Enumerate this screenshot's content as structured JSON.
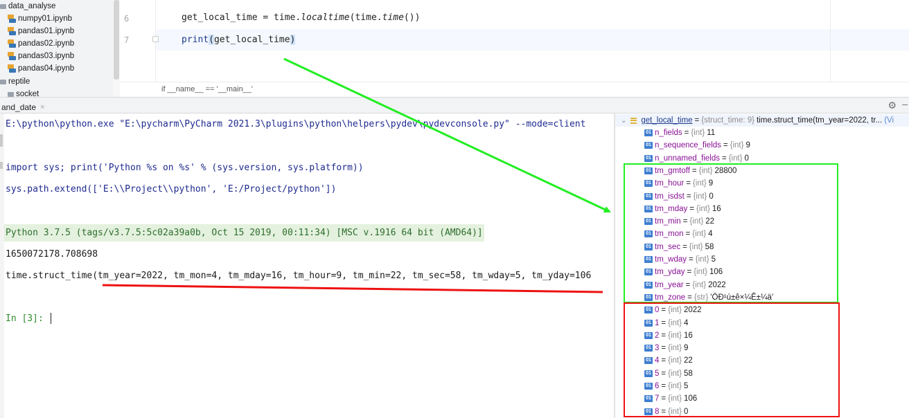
{
  "project_tree": {
    "items": [
      {
        "kind": "folder",
        "label": "data_analyse"
      },
      {
        "kind": "notebook",
        "label": "numpy01.ipynb"
      },
      {
        "kind": "notebook",
        "label": "pandas01.ipynb"
      },
      {
        "kind": "notebook",
        "label": "pandas02.ipynb"
      },
      {
        "kind": "notebook",
        "label": "pandas03.ipynb"
      },
      {
        "kind": "notebook",
        "label": "pandas04.ipynb"
      },
      {
        "kind": "folder",
        "label": "reptile"
      },
      {
        "kind": "folder",
        "label": "socket"
      }
    ]
  },
  "editor": {
    "line_numbers": [
      "6",
      "7"
    ],
    "line6": {
      "prefix": "get_local_time = time.",
      "fn1": "localtime",
      "mid": "(time.",
      "fn2": "time",
      "suffix": "())"
    },
    "line7": {
      "fn": "print",
      "open": "(",
      "arg": "get_local_time",
      "close": ")"
    },
    "breadcrumb": "if __name__ == '__main__'"
  },
  "run_tab": {
    "label": "and_date",
    "close_glyph": "×",
    "settings_icon": "gear-icon",
    "minimize_glyph": "–"
  },
  "console": {
    "lines": {
      "cmd1": "E:\\python\\python.exe \"E:\\pycharm\\PyCharm 2021.3\\plugins\\python\\helpers\\pydev\\pydevconsole.py\" --mode=client",
      "cmd2": "import sys; print('Python %s on %s' % (sys.version, sys.platform))",
      "cmd3": "sys.path.extend(['E:\\\\Project\\\\python', 'E:/Project/python'])",
      "banner": "Python 3.7.5 (tags/v3.7.5:5c02a39a0b, Oct 15 2019, 00:11:34) [MSC v.1916 64 bit (AMD64)]",
      "out1": "1650072178.708698",
      "out2": "time.struct_time(tm_year=2022, tm_mon=4, tm_mday=16, tm_hour=9, tm_min=22, tm_sec=58, tm_wday=5, tm_yday=106",
      "prompt": "In [3]:"
    }
  },
  "variables": {
    "header": {
      "name": "get_local_time",
      "eq": "=",
      "type": "{struct_time: 9}",
      "value": "time.struct_time(tm_year=2022, tr...",
      "more": "(Vi"
    },
    "icon_text": "01",
    "fields": [
      {
        "name": "n_fields",
        "type": "{int}",
        "value": "11"
      },
      {
        "name": "n_sequence_fields",
        "type": "{int}",
        "value": "9"
      },
      {
        "name": "n_unnamed_fields",
        "type": "{int}",
        "value": "0"
      },
      {
        "name": "tm_gmtoff",
        "type": "{int}",
        "value": "28800"
      },
      {
        "name": "tm_hour",
        "type": "{int}",
        "value": "9"
      },
      {
        "name": "tm_isdst",
        "type": "{int}",
        "value": "0"
      },
      {
        "name": "tm_mday",
        "type": "{int}",
        "value": "16"
      },
      {
        "name": "tm_min",
        "type": "{int}",
        "value": "22"
      },
      {
        "name": "tm_mon",
        "type": "{int}",
        "value": "4"
      },
      {
        "name": "tm_sec",
        "type": "{int}",
        "value": "58"
      },
      {
        "name": "tm_wday",
        "type": "{int}",
        "value": "5"
      },
      {
        "name": "tm_yday",
        "type": "{int}",
        "value": "106"
      },
      {
        "name": "tm_year",
        "type": "{int}",
        "value": "2022"
      },
      {
        "name": "tm_zone",
        "type": "{str}",
        "value": "'ÖÐ¹ú±ê×¼Ê±¼ä'"
      }
    ],
    "indices": [
      {
        "name": "0",
        "type": "{int}",
        "value": "2022"
      },
      {
        "name": "1",
        "type": "{int}",
        "value": "4"
      },
      {
        "name": "2",
        "type": "{int}",
        "value": "16"
      },
      {
        "name": "3",
        "type": "{int}",
        "value": "9"
      },
      {
        "name": "4",
        "type": "{int}",
        "value": "22"
      },
      {
        "name": "5",
        "type": "{int}",
        "value": "58"
      },
      {
        "name": "6",
        "type": "{int}",
        "value": "5"
      },
      {
        "name": "7",
        "type": "{int}",
        "value": "106"
      },
      {
        "name": "8",
        "type": "{int}",
        "value": "0"
      }
    ]
  },
  "annotation_colors": {
    "green": "#22ee22",
    "red": "#ee1111"
  }
}
